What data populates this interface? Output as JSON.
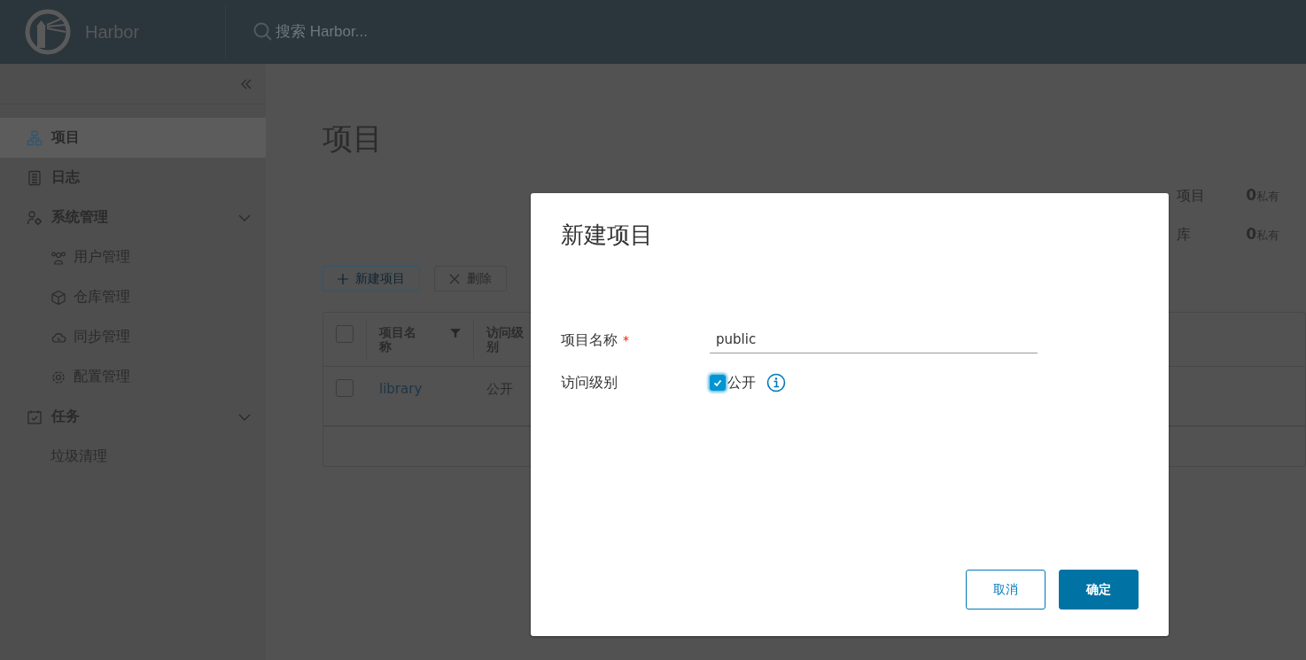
{
  "header": {
    "logo_text": "Harbor",
    "search": {
      "placeholder": "搜索 Harbor..."
    }
  },
  "sidebar": {
    "items": [
      {
        "label": "项目",
        "selected": true
      },
      {
        "label": "日志",
        "selected": false
      },
      {
        "label": "系统管理",
        "selected": false,
        "expanded": true,
        "children": [
          {
            "label": "用户管理",
            "selected": false
          },
          {
            "label": "仓库管理",
            "selected": false
          },
          {
            "label": "同步管理",
            "selected": false
          },
          {
            "label": "配置管理",
            "selected": false
          }
        ]
      },
      {
        "label": "任务",
        "selected": false,
        "expanded": true,
        "children": [
          {
            "label": "垃圾清理",
            "selected": false
          }
        ]
      }
    ]
  },
  "main": {
    "title": "项目",
    "stats": [
      {
        "label": "项目",
        "count": "0",
        "suffix": "私有"
      },
      {
        "label": "库",
        "count": "0",
        "suffix": "私有"
      }
    ],
    "toolbar": [
      {
        "label": "新建项目",
        "kind": "add",
        "disabled": false
      },
      {
        "label": "删除",
        "kind": "delete",
        "disabled": true
      }
    ],
    "table": {
      "select_all": {
        "checked": false
      },
      "columns": [
        {
          "label": "项目名称"
        },
        {
          "label": "访问级别"
        }
      ],
      "rows": [
        {
          "cells": [
            "library",
            "公开"
          ],
          "selected": false
        }
      ]
    }
  },
  "modal": {
    "title": "新建项目",
    "fields": [
      {
        "kind": "text",
        "label": "项目名称",
        "required_mark": "*",
        "value": "public"
      },
      {
        "kind": "checkbox",
        "label": "访问级别",
        "option": "公开",
        "checked": true
      }
    ],
    "buttons": [
      {
        "label": "取消",
        "kind": "secondary"
      },
      {
        "label": "确定",
        "kind": "primary"
      }
    ]
  }
}
